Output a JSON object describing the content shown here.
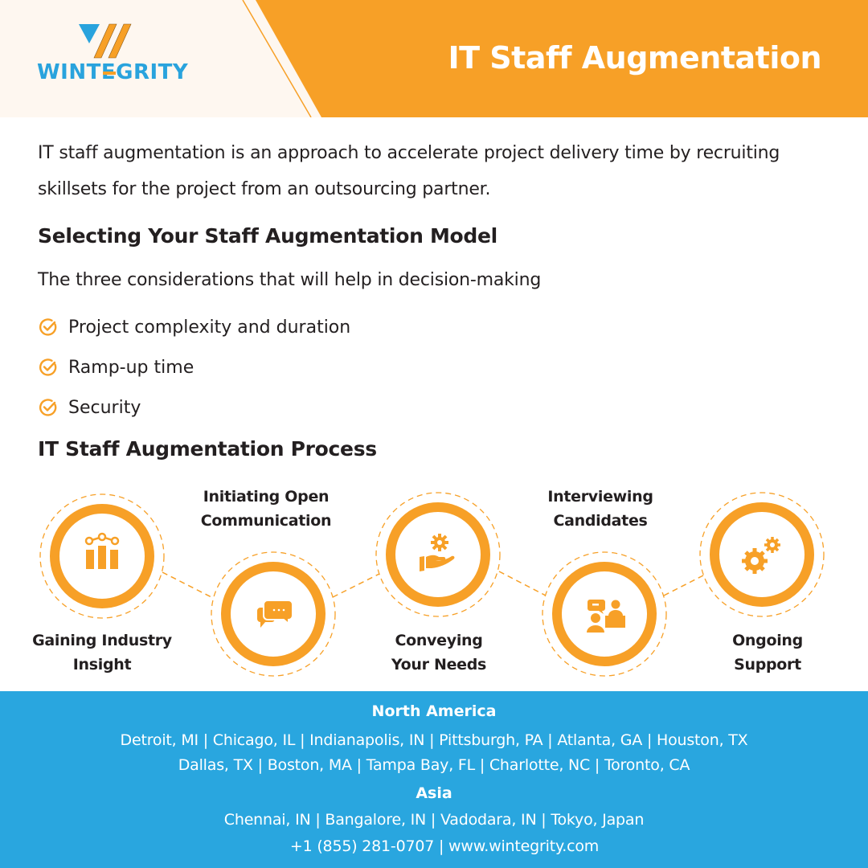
{
  "brand": {
    "name": "WINTEGRITY",
    "colors": {
      "orange": "#f7a027",
      "blue": "#29a6df",
      "cream": "#fef7f0",
      "text": "#231f20"
    }
  },
  "header": {
    "title": "IT Staff Augmentation",
    "logo_text_left": "WINT",
    "logo_text_e": "E",
    "logo_text_right": "GRITY"
  },
  "intro": {
    "text": "IT staff augmentation is an approach to accelerate project delivery time by recruiting skillsets for the project from an outsourcing partner."
  },
  "model_section": {
    "heading": "Selecting Your Staff Augmentation Model",
    "lead": "The three considerations that will help in decision-making",
    "items": [
      {
        "icon": "check-circle-icon",
        "label": "Project complexity and duration"
      },
      {
        "icon": "check-circle-icon",
        "label": "Ramp-up time"
      },
      {
        "icon": "check-circle-icon",
        "label": "Security"
      }
    ]
  },
  "process_section": {
    "heading": "IT Staff Augmentation Process",
    "steps": [
      {
        "icon": "bar-chart-icon",
        "line1": "Gaining Industry",
        "line2": "Insight",
        "label_position": "below"
      },
      {
        "icon": "chat-bubbles-icon",
        "line1": "Initiating Open",
        "line2": "Communication",
        "label_position": "above"
      },
      {
        "icon": "hand-gear-icon",
        "line1": "Conveying",
        "line2": "Your Needs",
        "label_position": "below"
      },
      {
        "icon": "interview-icon",
        "line1": "Interviewing",
        "line2": "Candidates",
        "label_position": "above"
      },
      {
        "icon": "gears-icon",
        "line1": "Ongoing",
        "line2": "Support",
        "label_position": "below"
      }
    ]
  },
  "footer": {
    "north_america": {
      "heading": "North America",
      "line1": "Detroit, MI | Chicago, IL | Indianapolis, IN | Pittsburgh, PA | Atlanta, GA | Houston, TX",
      "line2": "Dallas, TX | Boston, MA | Tampa Bay, FL | Charlotte, NC | Toronto, CA"
    },
    "asia": {
      "heading": "Asia",
      "line1": "Chennai, IN | Bangalore, IN | Vadodara, IN | Tokyo, Japan"
    },
    "contact": "+1 (855) 281-0707 | www.wintegrity.com"
  }
}
